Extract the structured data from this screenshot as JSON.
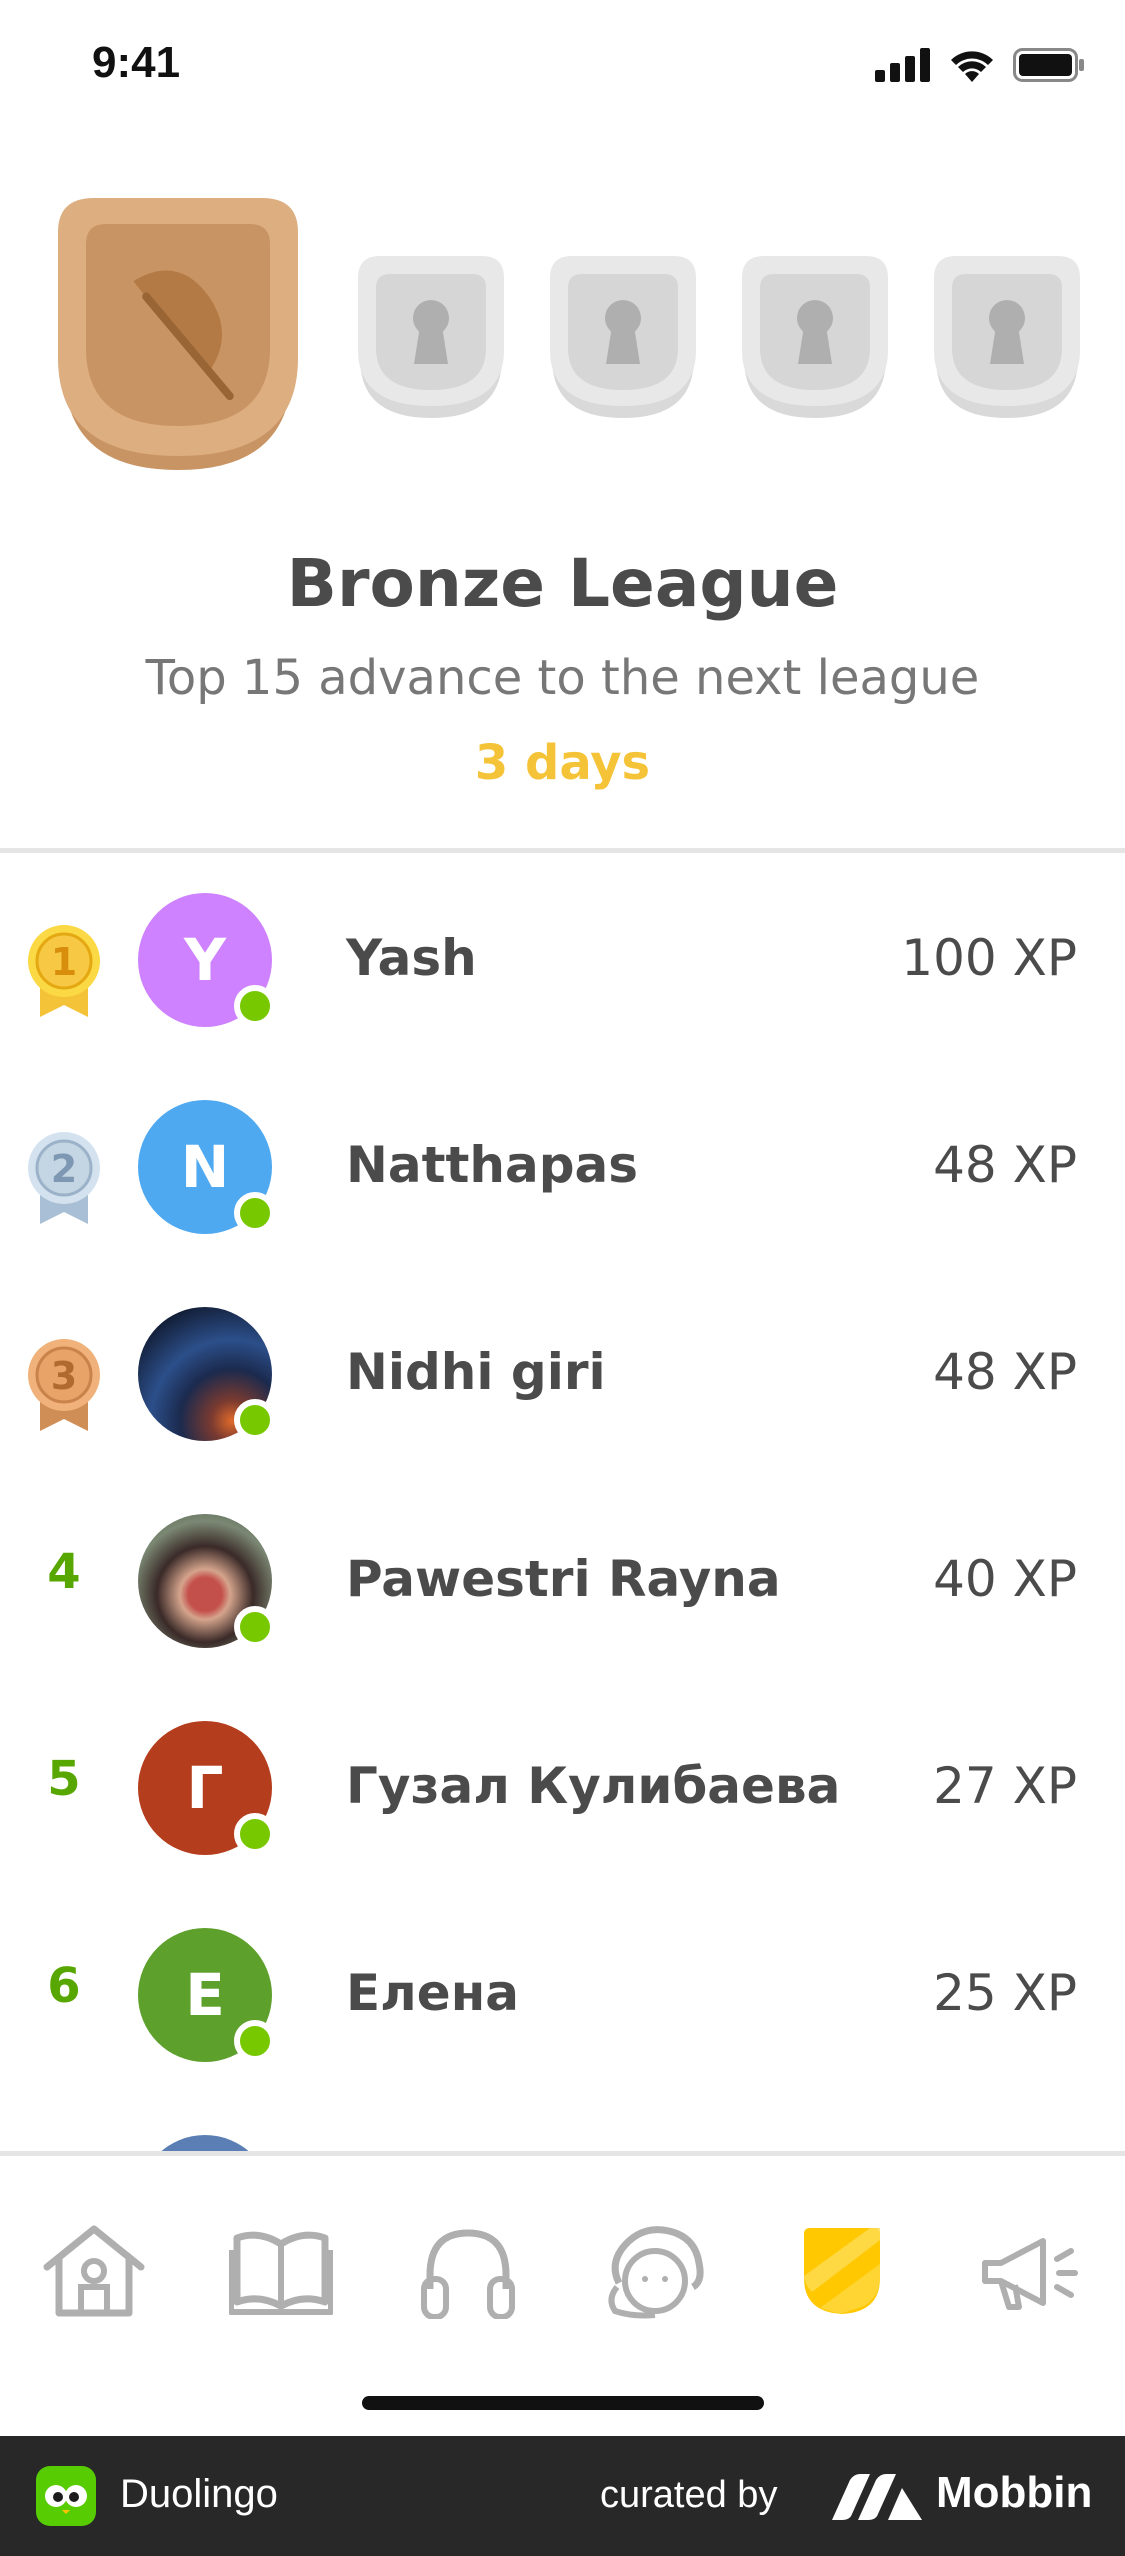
{
  "status_bar": {
    "time": "9:41"
  },
  "leagues": {
    "current": {
      "name": "Bronze League",
      "icon": "feather-icon",
      "color": "#cd9a62"
    },
    "locked_count": 4
  },
  "header": {
    "title": "Bronze League",
    "subtitle": "Top 15 advance to the next league",
    "time_left": "3 days"
  },
  "leaderboard": [
    {
      "rank": "1",
      "name": "Yash",
      "xp": "100 XP",
      "initial": "Y",
      "avatar_color": "#ce82ff",
      "medal": "gold"
    },
    {
      "rank": "2",
      "name": "Natthapas",
      "xp": "48 XP",
      "initial": "N",
      "avatar_color": "#4fa9f1",
      "medal": "silver"
    },
    {
      "rank": "3",
      "name": "Nidhi giri",
      "xp": "48 XP",
      "initial": "",
      "avatar_color": "#1d2340",
      "medal": "bronze"
    },
    {
      "rank": "4",
      "name": "Pawestri Rayna",
      "xp": "40 XP",
      "initial": "",
      "avatar_color": "#5b4a44",
      "medal": ""
    },
    {
      "rank": "5",
      "name": "Гузал Кулибаева",
      "xp": "27 XP",
      "initial": "Г",
      "avatar_color": "#b43d1d",
      "medal": ""
    },
    {
      "rank": "6",
      "name": "Елена",
      "xp": "25 XP",
      "initial": "Е",
      "avatar_color": "#5ea02c",
      "medal": ""
    }
  ],
  "tabbar": {
    "tabs": [
      {
        "icon": "home-icon"
      },
      {
        "icon": "book-icon"
      },
      {
        "icon": "headphones-icon"
      },
      {
        "icon": "character-icon"
      },
      {
        "icon": "league-shield-icon",
        "active": true
      },
      {
        "icon": "megaphone-icon"
      }
    ]
  },
  "footer": {
    "app_name": "Duolingo",
    "curated_by": "curated by",
    "brand": "Mobbin"
  }
}
